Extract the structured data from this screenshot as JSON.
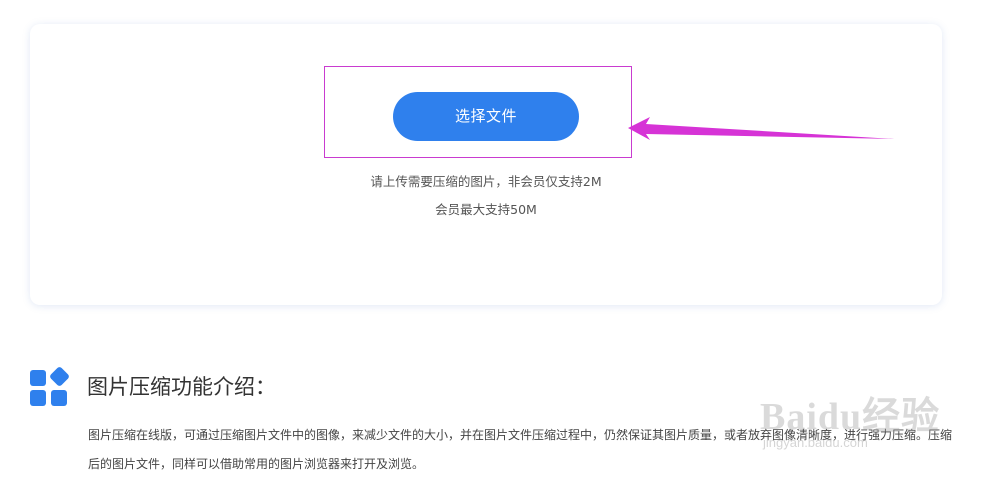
{
  "upload": {
    "button_label": "选择文件",
    "hint_line1": "请上传需要压缩的图片，非会员仅支持2M",
    "hint_line2": "会员最大支持50M"
  },
  "intro": {
    "icon": "grid-apps-icon",
    "title": "图片压缩功能介绍：",
    "description": "图片压缩在线版，可通过压缩图片文件中的图像，来减少文件的大小，并在图片文件压缩过程中，仍然保证其图片质量，或者放弃图像清晰度，进行强力压缩。压缩后的图片文件，同样可以借助常用的图片浏览器来打开及浏览。"
  },
  "watermark": {
    "brand": "Baidu经验",
    "url": "jingyan.baidu.com"
  },
  "colors": {
    "accent": "#2f80ed",
    "annotation": "#d633d6"
  }
}
